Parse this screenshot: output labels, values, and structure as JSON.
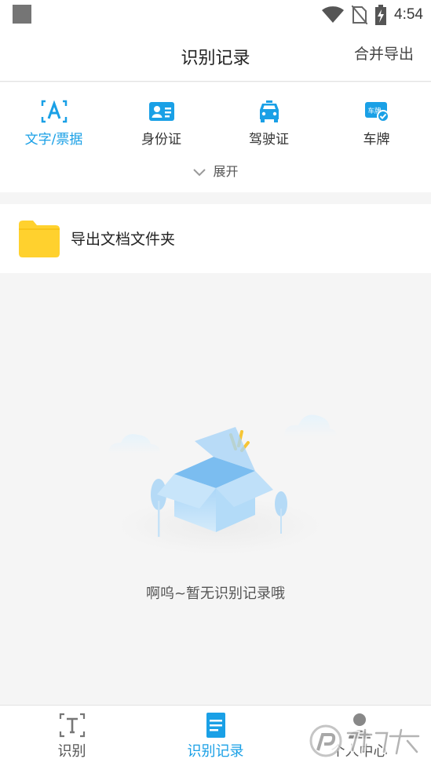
{
  "status_bar": {
    "time": "4:54"
  },
  "header": {
    "title": "识别记录",
    "action": "合并导出"
  },
  "categories": {
    "items": [
      {
        "label": "文字/票据",
        "icon": "text-scan-icon",
        "active": true
      },
      {
        "label": "身份证",
        "icon": "id-card-icon",
        "active": false
      },
      {
        "label": "驾驶证",
        "icon": "car-icon",
        "active": false
      },
      {
        "label": "车牌",
        "icon": "license-plate-icon",
        "active": false,
        "badge": "车牌"
      }
    ],
    "expand_label": "展开"
  },
  "folder": {
    "label": "导出文档文件夹"
  },
  "empty_state": {
    "message": "啊呜~暂无识别记录哦"
  },
  "tabbar": {
    "items": [
      {
        "label": "识别",
        "icon": "scan-text-icon",
        "active": false
      },
      {
        "label": "识别记录",
        "icon": "document-icon",
        "active": true
      },
      {
        "label": "个人中心",
        "icon": "user-icon",
        "active": false
      }
    ]
  },
  "colors": {
    "accent": "#1aa0e6",
    "folder": "#ffd12e",
    "box": "#a9d4f7"
  }
}
